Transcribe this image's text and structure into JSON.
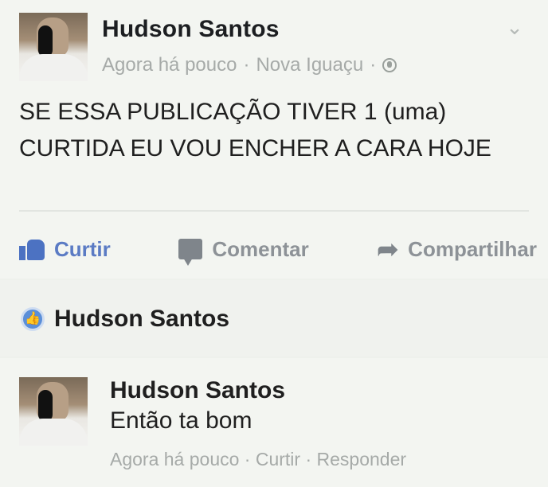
{
  "post": {
    "author": "Hudson Santos",
    "time": "Agora há pouco",
    "separator": "·",
    "location": "Nova Iguaçu",
    "separator2": "·",
    "text": "SE ESSA PUBLICAÇÃO TIVER 1 (uma) CURTIDA EU VOU ENCHER A CARA HOJE",
    "actions": {
      "like": "Curtir",
      "comment": "Comentar",
      "share": "Compartilhar"
    }
  },
  "likes": {
    "name": "Hudson Santos"
  },
  "comment": {
    "author": "Hudson Santos",
    "text": "Então ta bom",
    "meta": "Agora há pouco · Curtir · Responder"
  },
  "colors": {
    "background": "#eef1ec",
    "like_blue": "#4c72c2",
    "muted_text": "#a6aaa8"
  },
  "icons": [
    "thumbs-up-icon",
    "comment-icon",
    "share-arrow-icon",
    "globe-icon",
    "chevron-down-icon",
    "like-badge-icon"
  ]
}
